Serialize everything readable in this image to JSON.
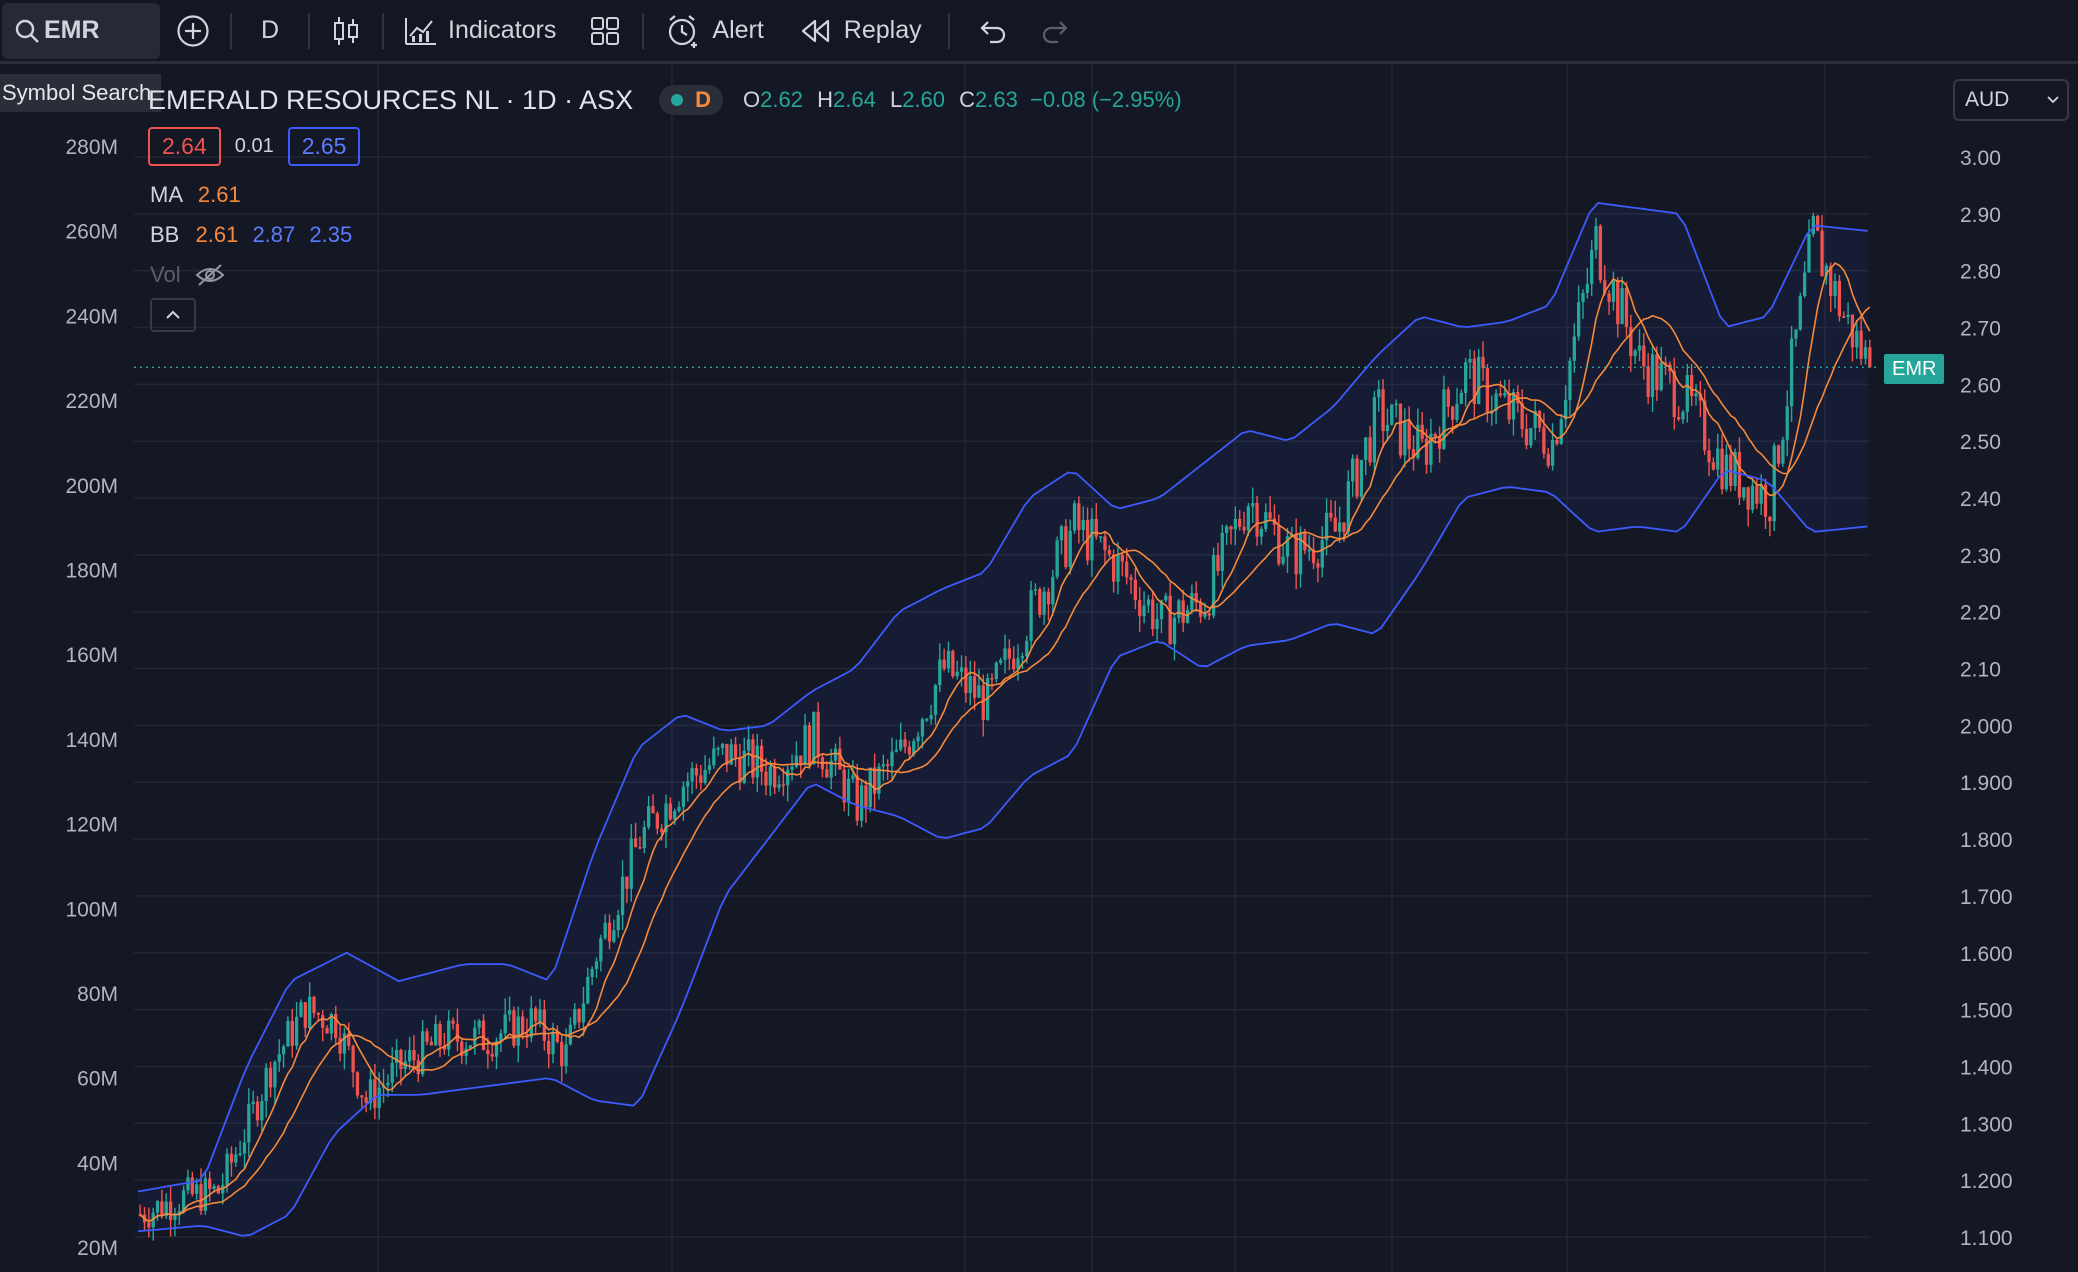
{
  "toolbar": {
    "symbol": "EMR",
    "interval": "D",
    "indicators_label": "Indicators",
    "alert_label": "Alert",
    "replay_label": "Replay"
  },
  "tooltip": "Symbol Search",
  "header": {
    "title": "EMERALD RESOURCES NL · 1D · ASX",
    "market_badge": "D",
    "o_label": "O",
    "o": "2.62",
    "h_label": "H",
    "h": "2.64",
    "l_label": "L",
    "l": "2.60",
    "c_label": "C",
    "c": "2.63",
    "change": "−0.08 (−2.95%)"
  },
  "trade": {
    "sell": "2.64",
    "spread": "0.01",
    "buy": "2.65"
  },
  "indicators": {
    "ma_label": "MA",
    "ma_value": "2.61",
    "bb_label": "BB",
    "bb_basis": "2.61",
    "bb_upper": "2.87",
    "bb_lower": "2.35",
    "vol_label": "Vol"
  },
  "currency": "AUD",
  "price_tag": "EMR",
  "colors": {
    "up": "#26a69a",
    "down": "#ef5350",
    "ma": "#f7893b",
    "bb": "#3d5afe",
    "bg": "#141824",
    "grid": "#232733",
    "text": "#b2b5be"
  },
  "chart_data": {
    "type": "candlestick",
    "y_right_ticks": [
      "3.00",
      "2.90",
      "2.80",
      "2.70",
      "2.60",
      "2.50",
      "2.40",
      "2.30",
      "2.20",
      "2.10",
      "2.000",
      "1.900",
      "1.800",
      "1.700",
      "1.600",
      "1.500",
      "1.400",
      "1.300",
      "1.200",
      "1.100"
    ],
    "y_left_ticks": [
      "280M",
      "260M",
      "240M",
      "220M",
      "200M",
      "180M",
      "160M",
      "140M",
      "120M",
      "100M",
      "80M",
      "60M",
      "40M",
      "20M"
    ],
    "ylim": [
      1.05,
      3.0
    ],
    "last_price": 2.63,
    "trend": [
      [
        0,
        1.14
      ],
      [
        10,
        1.17
      ],
      [
        18,
        1.18
      ],
      [
        25,
        1.3
      ],
      [
        30,
        1.4
      ],
      [
        38,
        1.5
      ],
      [
        45,
        1.48
      ],
      [
        52,
        1.34
      ],
      [
        60,
        1.4
      ],
      [
        70,
        1.45
      ],
      [
        80,
        1.45
      ],
      [
        90,
        1.48
      ],
      [
        98,
        1.42
      ],
      [
        105,
        1.6
      ],
      [
        115,
        1.8
      ],
      [
        125,
        1.9
      ],
      [
        135,
        1.95
      ],
      [
        145,
        1.92
      ],
      [
        155,
        1.98
      ],
      [
        165,
        1.86
      ],
      [
        175,
        1.95
      ],
      [
        185,
        2.1
      ],
      [
        195,
        2.04
      ],
      [
        205,
        2.2
      ],
      [
        215,
        2.35
      ],
      [
        225,
        2.28
      ],
      [
        235,
        2.18
      ],
      [
        245,
        2.22
      ],
      [
        255,
        2.4
      ],
      [
        265,
        2.3
      ],
      [
        275,
        2.34
      ],
      [
        285,
        2.55
      ],
      [
        295,
        2.48
      ],
      [
        305,
        2.62
      ],
      [
        315,
        2.55
      ],
      [
        325,
        2.5
      ],
      [
        335,
        2.85
      ],
      [
        345,
        2.64
      ],
      [
        355,
        2.58
      ],
      [
        365,
        2.45
      ],
      [
        375,
        2.4
      ],
      [
        385,
        2.86
      ],
      [
        392,
        2.72
      ],
      [
        398,
        2.63
      ]
    ],
    "bb_upper": [
      [
        0,
        1.18
      ],
      [
        15,
        1.2
      ],
      [
        25,
        1.4
      ],
      [
        35,
        1.55
      ],
      [
        48,
        1.6
      ],
      [
        60,
        1.55
      ],
      [
        75,
        1.58
      ],
      [
        85,
        1.58
      ],
      [
        95,
        1.55
      ],
      [
        105,
        1.78
      ],
      [
        115,
        1.96
      ],
      [
        125,
        2.02
      ],
      [
        135,
        1.99
      ],
      [
        145,
        2.0
      ],
      [
        155,
        2.06
      ],
      [
        165,
        2.1
      ],
      [
        175,
        2.2
      ],
      [
        185,
        2.24
      ],
      [
        195,
        2.27
      ],
      [
        205,
        2.4
      ],
      [
        215,
        2.45
      ],
      [
        225,
        2.38
      ],
      [
        235,
        2.4
      ],
      [
        245,
        2.46
      ],
      [
        255,
        2.52
      ],
      [
        265,
        2.5
      ],
      [
        275,
        2.56
      ],
      [
        285,
        2.65
      ],
      [
        295,
        2.72
      ],
      [
        305,
        2.7
      ],
      [
        315,
        2.71
      ],
      [
        325,
        2.74
      ],
      [
        335,
        2.92
      ],
      [
        345,
        2.91
      ],
      [
        355,
        2.9
      ],
      [
        365,
        2.7
      ],
      [
        375,
        2.72
      ],
      [
        385,
        2.88
      ],
      [
        398,
        2.87
      ]
    ],
    "bb_lower": [
      [
        0,
        1.11
      ],
      [
        15,
        1.12
      ],
      [
        25,
        1.1
      ],
      [
        35,
        1.14
      ],
      [
        45,
        1.28
      ],
      [
        55,
        1.35
      ],
      [
        65,
        1.35
      ],
      [
        75,
        1.36
      ],
      [
        85,
        1.37
      ],
      [
        95,
        1.38
      ],
      [
        105,
        1.34
      ],
      [
        115,
        1.33
      ],
      [
        125,
        1.5
      ],
      [
        135,
        1.7
      ],
      [
        145,
        1.8
      ],
      [
        155,
        1.9
      ],
      [
        165,
        1.86
      ],
      [
        175,
        1.84
      ],
      [
        185,
        1.8
      ],
      [
        195,
        1.82
      ],
      [
        205,
        1.91
      ],
      [
        215,
        1.95
      ],
      [
        225,
        2.12
      ],
      [
        235,
        2.15
      ],
      [
        245,
        2.1
      ],
      [
        255,
        2.14
      ],
      [
        265,
        2.15
      ],
      [
        275,
        2.18
      ],
      [
        285,
        2.16
      ],
      [
        295,
        2.27
      ],
      [
        305,
        2.4
      ],
      [
        315,
        2.42
      ],
      [
        325,
        2.41
      ],
      [
        335,
        2.34
      ],
      [
        345,
        2.35
      ],
      [
        355,
        2.34
      ],
      [
        365,
        2.45
      ],
      [
        375,
        2.43
      ],
      [
        385,
        2.34
      ],
      [
        398,
        2.35
      ]
    ]
  }
}
